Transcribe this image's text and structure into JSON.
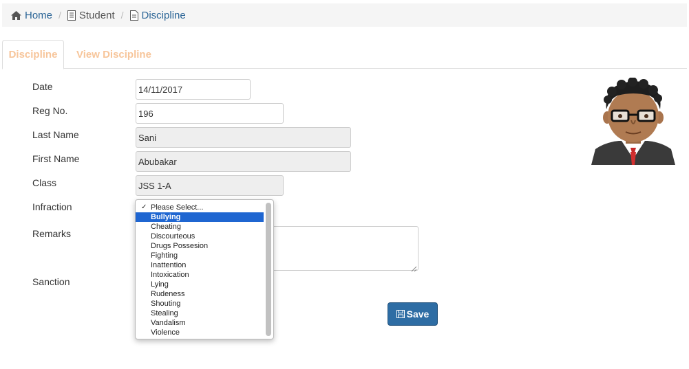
{
  "breadcrumb": {
    "home": "Home",
    "student": "Student",
    "current": "Discipline",
    "separator": "/"
  },
  "tabs": [
    {
      "label": "Discipline",
      "active": true
    },
    {
      "label": "View Discipline",
      "active": false
    }
  ],
  "form": {
    "date_label": "Date",
    "date_value": "14/11/2017",
    "reg_label": "Reg No.",
    "reg_value": "196",
    "last_name_label": "Last Name",
    "last_name_value": "Sani",
    "first_name_label": "First Name",
    "first_name_value": "Abubakar",
    "class_label": "Class",
    "class_value": "JSS 1-A",
    "infraction_label": "Infraction",
    "remarks_label": "Remarks",
    "sanction_label": "Sanction",
    "remarks_value": ""
  },
  "infraction_dropdown": {
    "options": [
      "Please Select...",
      "Bullying",
      "Cheating",
      "Discourteous",
      "Drugs Possesion",
      "Fighting",
      "Inattention",
      "Intoxication",
      "Lying",
      "Rudeness",
      "Shouting",
      "Stealing",
      "Vandalism",
      "Violence"
    ],
    "checked": "Please Select...",
    "highlighted": "Bullying"
  },
  "save_button": {
    "label": "Save",
    "icon": "floppy-disk-icon"
  },
  "colors": {
    "link": "#2a6496",
    "tab_text": "#f7c59a",
    "primary_button": "#2e6da4",
    "highlight": "#1f66d1",
    "readonly_bg": "#eeeeee"
  },
  "icons": {
    "home": "home-icon",
    "student": "document-icon",
    "discipline": "file-icon",
    "avatar": "student-avatar"
  }
}
